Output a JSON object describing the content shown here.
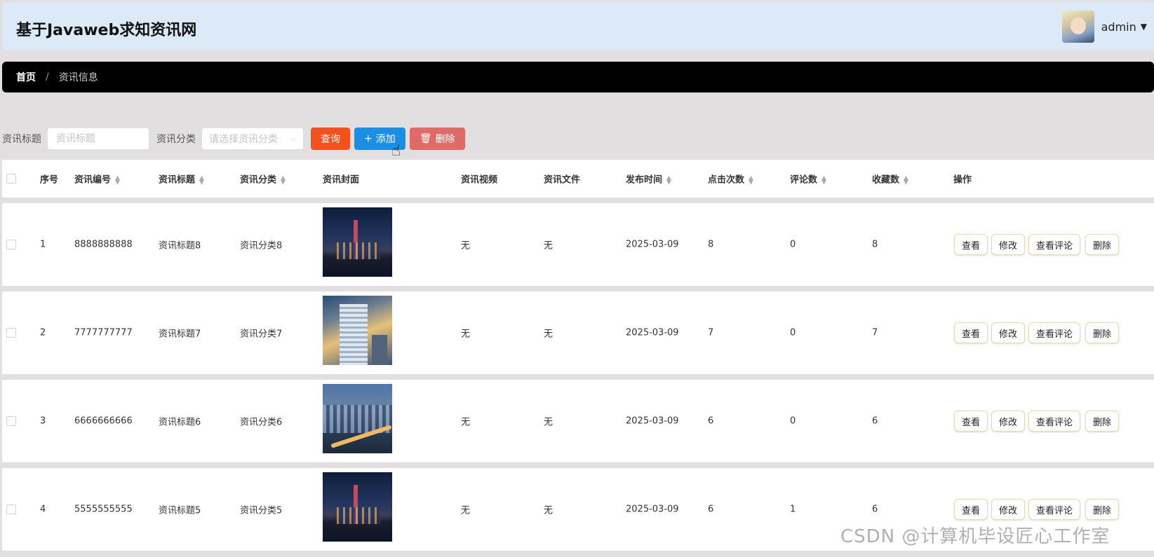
{
  "header": {
    "site_title": "基于Javaweb求知资讯网",
    "username": "admin"
  },
  "breadcrumb": {
    "home": "首页",
    "separator": "/",
    "current": "资讯信息"
  },
  "search": {
    "title_label": "资讯标题",
    "title_placeholder": "资讯标题",
    "category_label": "资讯分类",
    "category_placeholder": "请选择资讯分类",
    "query_button": "查询",
    "add_button": "添加",
    "delete_button": "删除"
  },
  "colors": {
    "query": "#f4511e",
    "add": "#1a8fe3",
    "delete": "#e06b66",
    "breadcrumb_bg": "#000000",
    "header_bg": "#dbeaf6"
  },
  "table": {
    "columns": [
      "序号",
      "资讯编号",
      "资讯标题",
      "资讯分类",
      "资讯封面",
      "资讯视频",
      "资讯文件",
      "发布时间",
      "点击次数",
      "评论数",
      "收藏数",
      "操作"
    ],
    "rows": [
      {
        "no": "1",
        "code": "8888888888",
        "title": "资讯标题8",
        "category": "资讯分类8",
        "cover": "night-skyline",
        "video": "无",
        "file": "无",
        "date": "2025-03-09",
        "clicks": "8",
        "comments": "0",
        "favorites": "8"
      },
      {
        "no": "2",
        "code": "7777777777",
        "title": "资讯标题7",
        "category": "资讯分类7",
        "cover": "skyscraper-sky",
        "video": "无",
        "file": "无",
        "date": "2025-03-09",
        "clicks": "7",
        "comments": "0",
        "favorites": "7"
      },
      {
        "no": "3",
        "code": "6666666666",
        "title": "资讯标题6",
        "category": "资讯分类6",
        "cover": "dusk-city",
        "video": "无",
        "file": "无",
        "date": "2025-03-09",
        "clicks": "6",
        "comments": "0",
        "favorites": "6"
      },
      {
        "no": "4",
        "code": "5555555555",
        "title": "资讯标题5",
        "category": "资讯分类5",
        "cover": "night-skyline",
        "video": "无",
        "file": "无",
        "date": "2025-03-09",
        "clicks": "6",
        "comments": "1",
        "favorites": "6"
      }
    ],
    "actions": {
      "view": "查看",
      "edit": "修改",
      "view_comments": "查看评论",
      "delete": "删除"
    }
  },
  "watermark": "CSDN @计算机毕设匠心工作室"
}
